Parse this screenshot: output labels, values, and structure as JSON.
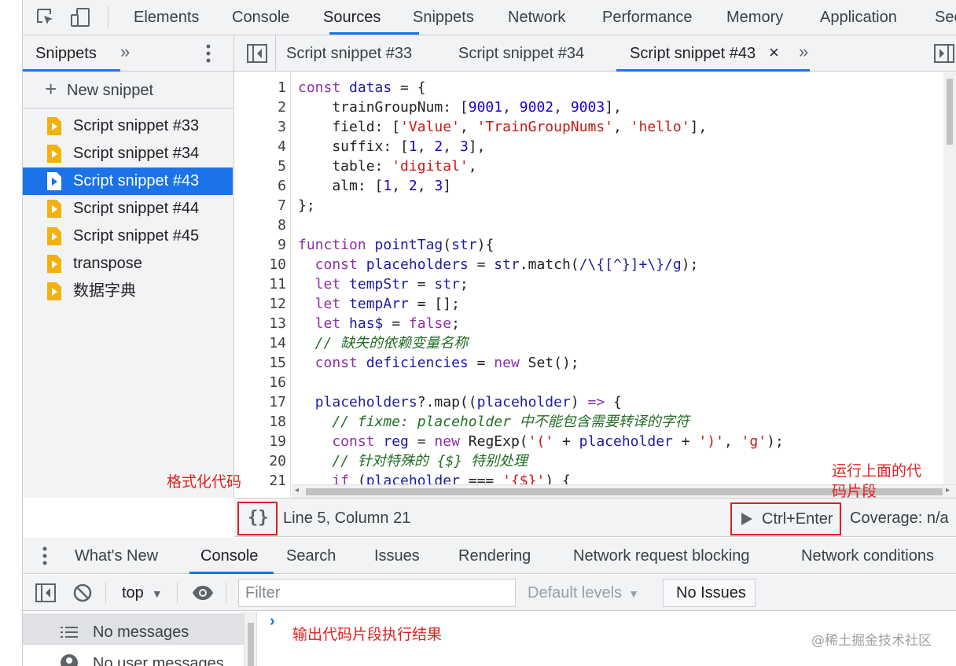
{
  "main_tabs": [
    "Elements",
    "Console",
    "Sources",
    "Snippets",
    "Network",
    "Performance",
    "Memory",
    "Application",
    "Sec"
  ],
  "active_main_tab": "Sources",
  "sidebar": {
    "tab_label": "Snippets",
    "new_snippet_label": "New snippet",
    "items": [
      {
        "label": "Script snippet #33"
      },
      {
        "label": "Script snippet #34"
      },
      {
        "label": "Script snippet #43",
        "selected": true
      },
      {
        "label": "Script snippet #44"
      },
      {
        "label": "Script snippet #45"
      },
      {
        "label": "transpose"
      },
      {
        "label": "数据字典"
      }
    ]
  },
  "editor_tabs": [
    {
      "label": "Script snippet #33"
    },
    {
      "label": "Script snippet #34"
    },
    {
      "label": "Script snippet #43",
      "active": true
    }
  ],
  "code": {
    "line_numbers": [
      "1",
      "2",
      "3",
      "4",
      "5",
      "6",
      "7",
      "8",
      "9",
      "10",
      "11",
      "12",
      "13",
      "14",
      "15",
      "16",
      "17",
      "18",
      "19",
      "20",
      "21"
    ],
    "lines": [
      [
        {
          "t": "const ",
          "c": "k"
        },
        {
          "t": "datas",
          "c": "v"
        },
        {
          "t": " = {",
          "c": ""
        }
      ],
      [
        {
          "t": "    trainGroupNum: [",
          "c": ""
        },
        {
          "t": "9001",
          "c": "n"
        },
        {
          "t": ", ",
          "c": ""
        },
        {
          "t": "9002",
          "c": "n"
        },
        {
          "t": ", ",
          "c": ""
        },
        {
          "t": "9003",
          "c": "n"
        },
        {
          "t": "],",
          "c": ""
        }
      ],
      [
        {
          "t": "    field: [",
          "c": ""
        },
        {
          "t": "'Value'",
          "c": "s"
        },
        {
          "t": ", ",
          "c": ""
        },
        {
          "t": "'TrainGroupNums'",
          "c": "s"
        },
        {
          "t": ", ",
          "c": ""
        },
        {
          "t": "'hello'",
          "c": "s"
        },
        {
          "t": "],",
          "c": ""
        }
      ],
      [
        {
          "t": "    suffix: [",
          "c": ""
        },
        {
          "t": "1",
          "c": "n"
        },
        {
          "t": ", ",
          "c": ""
        },
        {
          "t": "2",
          "c": "n"
        },
        {
          "t": ", ",
          "c": ""
        },
        {
          "t": "3",
          "c": "n"
        },
        {
          "t": "],",
          "c": ""
        }
      ],
      [
        {
          "t": "    table: ",
          "c": ""
        },
        {
          "t": "'digital'",
          "c": "s"
        },
        {
          "t": ",",
          "c": ""
        }
      ],
      [
        {
          "t": "    alm: [",
          "c": ""
        },
        {
          "t": "1",
          "c": "n"
        },
        {
          "t": ", ",
          "c": ""
        },
        {
          "t": "2",
          "c": "n"
        },
        {
          "t": ", ",
          "c": ""
        },
        {
          "t": "3",
          "c": "n"
        },
        {
          "t": "]",
          "c": ""
        }
      ],
      [
        {
          "t": "};",
          "c": ""
        }
      ],
      [
        {
          "t": "",
          "c": ""
        }
      ],
      [
        {
          "t": "function ",
          "c": "k"
        },
        {
          "t": "pointTag",
          "c": "v"
        },
        {
          "t": "(",
          "c": ""
        },
        {
          "t": "str",
          "c": "v"
        },
        {
          "t": "){",
          "c": ""
        }
      ],
      [
        {
          "t": "  const ",
          "c": "k"
        },
        {
          "t": "placeholders",
          "c": "v"
        },
        {
          "t": " = ",
          "c": ""
        },
        {
          "t": "str",
          "c": "v"
        },
        {
          "t": ".match(",
          "c": ""
        },
        {
          "t": "/\\{[^}]+\\}/g",
          "c": "r"
        },
        {
          "t": ");",
          "c": ""
        }
      ],
      [
        {
          "t": "  let ",
          "c": "k"
        },
        {
          "t": "tempStr",
          "c": "v"
        },
        {
          "t": " = ",
          "c": ""
        },
        {
          "t": "str",
          "c": "v"
        },
        {
          "t": ";",
          "c": ""
        }
      ],
      [
        {
          "t": "  let ",
          "c": "k"
        },
        {
          "t": "tempArr",
          "c": "v"
        },
        {
          "t": " = [];",
          "c": ""
        }
      ],
      [
        {
          "t": "  let ",
          "c": "k"
        },
        {
          "t": "has$",
          "c": "v"
        },
        {
          "t": " = ",
          "c": ""
        },
        {
          "t": "false",
          "c": "k"
        },
        {
          "t": ";",
          "c": ""
        }
      ],
      [
        {
          "t": "  // 缺失的依赖变量名称",
          "c": "c"
        }
      ],
      [
        {
          "t": "  const ",
          "c": "k"
        },
        {
          "t": "deficiencies",
          "c": "v"
        },
        {
          "t": " = ",
          "c": ""
        },
        {
          "t": "new ",
          "c": "k"
        },
        {
          "t": "Set();",
          "c": ""
        }
      ],
      [
        {
          "t": "",
          "c": ""
        }
      ],
      [
        {
          "t": "  ",
          "c": ""
        },
        {
          "t": "placeholders",
          "c": "v"
        },
        {
          "t": "?.map((",
          "c": ""
        },
        {
          "t": "placeholder",
          "c": "v"
        },
        {
          "t": ") ",
          "c": ""
        },
        {
          "t": "=>",
          "c": "k"
        },
        {
          "t": " {",
          "c": ""
        }
      ],
      [
        {
          "t": "    // fixme: placeholder 中不能包含需要转译的字符",
          "c": "c"
        }
      ],
      [
        {
          "t": "    const ",
          "c": "k"
        },
        {
          "t": "reg",
          "c": "v"
        },
        {
          "t": " = ",
          "c": ""
        },
        {
          "t": "new ",
          "c": "k"
        },
        {
          "t": "RegExp(",
          "c": ""
        },
        {
          "t": "'('",
          "c": "s"
        },
        {
          "t": " + ",
          "c": ""
        },
        {
          "t": "placeholder",
          "c": "v"
        },
        {
          "t": " + ",
          "c": ""
        },
        {
          "t": "')'",
          "c": "s"
        },
        {
          "t": ", ",
          "c": ""
        },
        {
          "t": "'g'",
          "c": "s"
        },
        {
          "t": ");",
          "c": ""
        }
      ],
      [
        {
          "t": "    // 针对特殊的 {$} 特别处理",
          "c": "c"
        }
      ],
      [
        {
          "t": "    if ",
          "c": "k"
        },
        {
          "t": "(",
          "c": ""
        },
        {
          "t": "placeholder",
          "c": "v"
        },
        {
          "t": " === ",
          "c": ""
        },
        {
          "t": "'{$}'",
          "c": "s"
        },
        {
          "t": ") {",
          "c": ""
        }
      ]
    ]
  },
  "status": {
    "format_glyph": "{}",
    "position": "Line 5, Column 21",
    "run_label": "Ctrl+Enter",
    "coverage": "Coverage: n/a"
  },
  "annotations": {
    "format_note": "格式化代码",
    "run_note_line1": "运行上面的代",
    "run_note_line2": "码片段",
    "output_note": "输出代码片段执行结果"
  },
  "drawer_tabs": [
    "What's New",
    "Console",
    "Search",
    "Issues",
    "Rendering",
    "Network request blocking",
    "Network conditions"
  ],
  "active_drawer_tab": "Console",
  "console": {
    "context": "top",
    "filter_placeholder": "Filter",
    "levels": "Default levels",
    "issues": "No Issues",
    "sidebar_items": [
      "No messages",
      "No user messages"
    ]
  },
  "watermark": "@稀土掘金技术社区",
  "colors": {
    "accent": "#1a73e8",
    "annotation": "#e02020",
    "snippet_icon": "#f2b10c"
  }
}
